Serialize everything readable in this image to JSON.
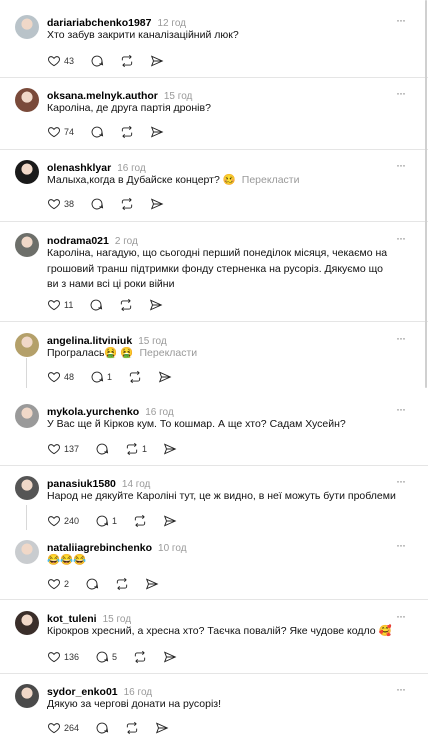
{
  "comments": [
    {
      "username": "dariariabchenko1987",
      "time": "12 год",
      "text": "Хто забув закрити каналізаційний люк?",
      "likes": "43",
      "replies": "",
      "reposts": "",
      "translate": "",
      "avatar_color": "#b9c3c9"
    },
    {
      "username": "oksana.melnyk.author",
      "time": "15 год",
      "text": "Кароліна, де друга партія дронів?",
      "likes": "74",
      "replies": "",
      "reposts": "",
      "translate": "",
      "avatar_color": "#7a4a3a"
    },
    {
      "username": "olenashklyar",
      "time": "16 год",
      "text": "Малыха,когда в Дубайске концерт? 🥴",
      "likes": "38",
      "replies": "",
      "reposts": "",
      "translate": "Перекласти",
      "avatar_color": "#1a1a1a"
    },
    {
      "username": "nodrama021",
      "time": "2 год",
      "text": "Кароліна, нагадую, що сьогодні перший понеділок місяця, чекаємо на грошовий транш підтримки фонду стерненка на русоріз. Дякуємо що ви з нами всі ці роки війни",
      "likes": "11",
      "replies": "",
      "reposts": "",
      "translate": "",
      "avatar_color": "#6d6f6a"
    },
    {
      "username": "angelina.litviniuk",
      "time": "15 год",
      "text": "Програлась🤮 🤮",
      "likes": "48",
      "replies": "1",
      "reposts": "",
      "translate": "Перекласти",
      "avatar_color": "#b4a06a"
    },
    {
      "username": "mykola.yurchenko",
      "time": "16 год",
      "text": "У Вас ще й Кірков кум. То кошмар. А ще хто? Садам Хусейн?",
      "likes": "137",
      "replies": "",
      "reposts": "1",
      "translate": "",
      "avatar_color": "#9a9a9a"
    },
    {
      "username": "panasiuk1580",
      "time": "14 год",
      "text": "Народ не дякуйте Кароліні тут, це ж видно, в неї можуть бути проблеми",
      "likes": "240",
      "replies": "1",
      "reposts": "",
      "translate": "",
      "avatar_color": "#555555"
    },
    {
      "username": "nataliiagrebinchenko",
      "time": "10 год",
      "text": "😂😂😂",
      "likes": "2",
      "replies": "",
      "reposts": "",
      "translate": "",
      "avatar_color": "#c9cccf"
    },
    {
      "username": "kot_tuleni",
      "time": "15 год",
      "text": "Кірокров хресний, а хресна хто? Таєчка повалій? Яке чудове кодло 🥰",
      "likes": "136",
      "replies": "5",
      "reposts": "",
      "translate": "",
      "avatar_color": "#3a2e2a"
    },
    {
      "username": "sydor_enko01",
      "time": "16 год",
      "text": "Дякую за чергові донати на русоріз!",
      "likes": "264",
      "replies": "",
      "reposts": "",
      "translate": "",
      "avatar_color": "#4a4a4a"
    }
  ],
  "more_label": "···",
  "icons": {
    "like": "heart-icon",
    "reply": "comment-icon",
    "repost": "repost-icon",
    "share": "share-icon"
  }
}
